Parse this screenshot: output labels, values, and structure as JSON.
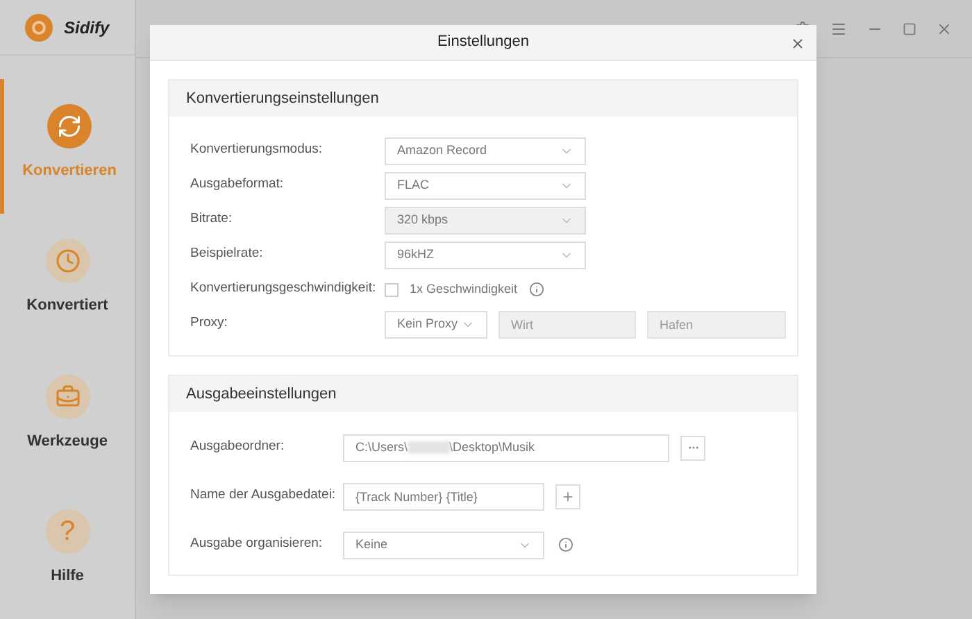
{
  "app": {
    "name": "Sidify"
  },
  "sidebar": {
    "items": [
      {
        "label": "Konvertieren",
        "selected": true
      },
      {
        "label": "Konvertiert",
        "selected": false
      },
      {
        "label": "Werkzeuge",
        "selected": false
      },
      {
        "label": "Hilfe",
        "glyph": "?",
        "selected": false
      }
    ]
  },
  "dialog": {
    "title": "Einstellungen",
    "conversion": {
      "title": "Konvertierungseinstellungen",
      "rows": [
        {
          "kind": "select",
          "label": "Konvertierungsmodus:",
          "value": "Amazon Record",
          "disabled": false
        },
        {
          "kind": "select",
          "label": "Ausgabeformat:",
          "value": "FLAC",
          "disabled": false
        },
        {
          "kind": "select",
          "label": "Bitrate:",
          "value": "320 kbps",
          "disabled": true
        },
        {
          "kind": "select",
          "label": "Beispielrate:",
          "value": "96kHZ",
          "disabled": false
        },
        {
          "kind": "checkbox",
          "label": "Konvertierungsgeschwindigkeit:",
          "option": "1x Geschwindigkeit",
          "checked": false
        },
        {
          "kind": "proxy",
          "label": "Proxy:",
          "value": "Kein Proxy",
          "host_placeholder": "Wirt",
          "port_placeholder": "Hafen"
        }
      ]
    },
    "output": {
      "title": "Ausgabeeinstellungen",
      "rows": [
        {
          "kind": "folder",
          "label": "Ausgabeordner:",
          "path_start": "C:\\Users\\",
          "path_end": "\\Desktop\\Musik"
        },
        {
          "kind": "filename",
          "label": "Name der Ausgabedatei:",
          "value": "{Track Number} {Title}"
        },
        {
          "kind": "select",
          "label": "Ausgabe organisieren:",
          "value": "Keine"
        }
      ]
    }
  }
}
